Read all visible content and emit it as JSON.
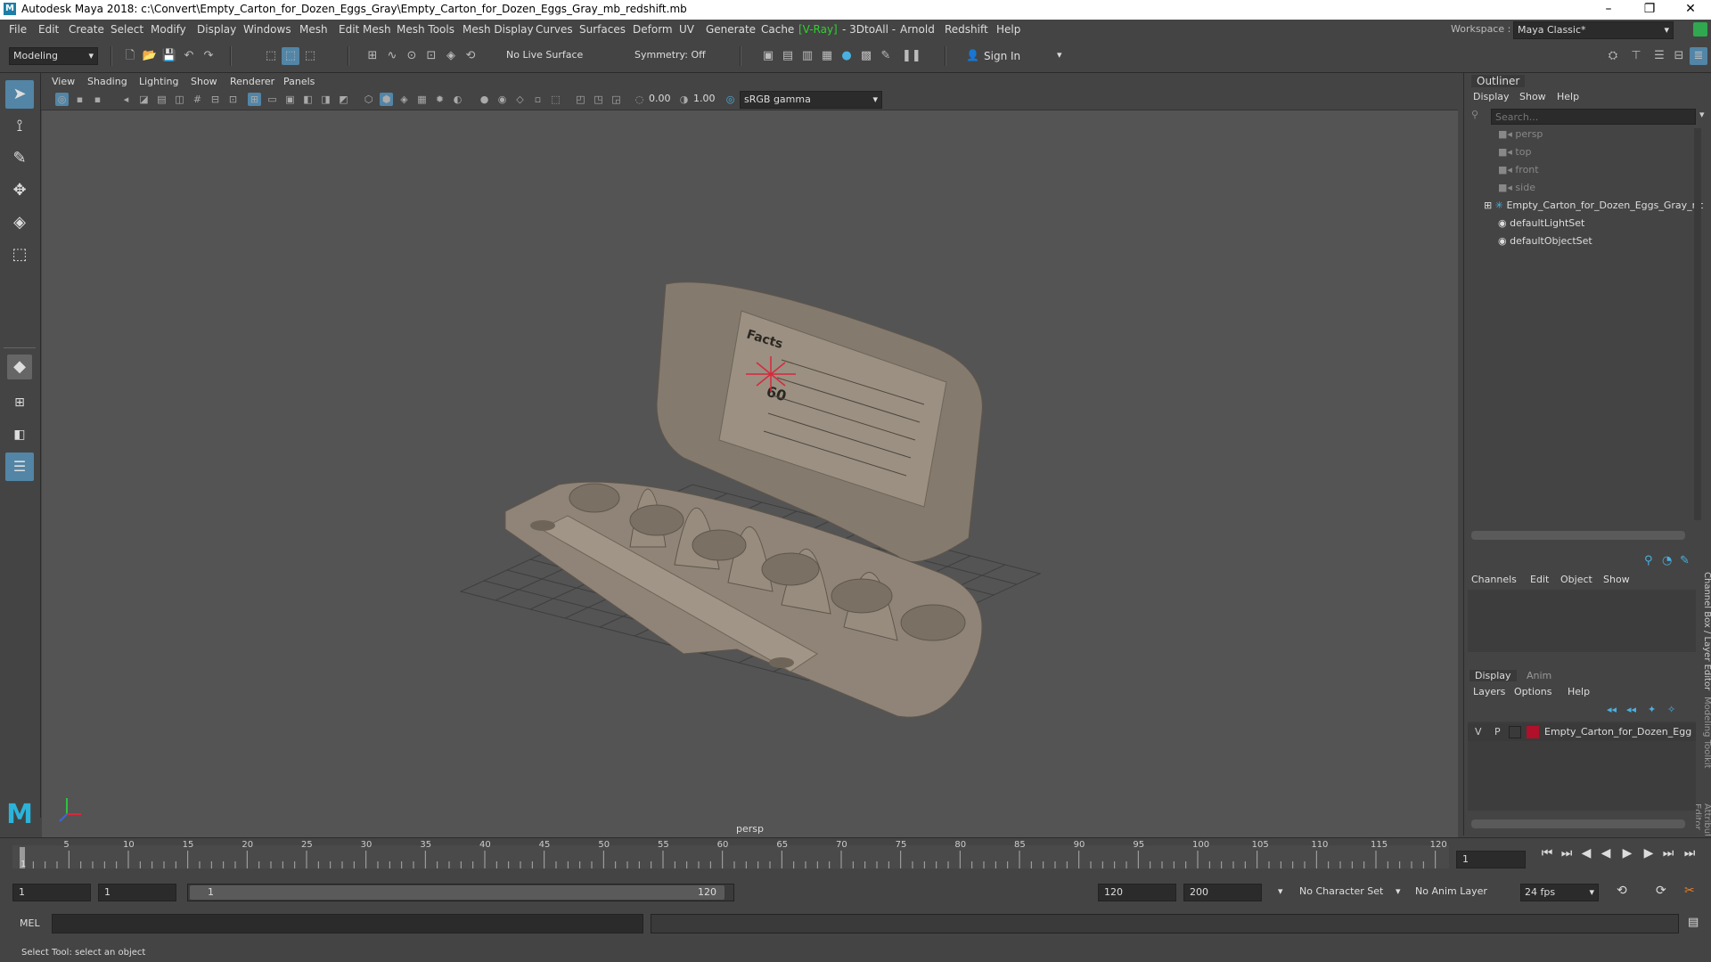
{
  "window": {
    "title": "Autodesk Maya 2018: c:\\Convert\\Empty_Carton_for_Dozen_Eggs_Gray\\Empty_Carton_for_Dozen_Eggs_Gray_mb_redshift.mb",
    "logo_letter": "M",
    "minimize": "–",
    "maximize": "❐",
    "close": "✕"
  },
  "menu": {
    "items": [
      "File",
      "Edit",
      "Create",
      "Select",
      "Modify",
      "Display",
      "Windows",
      "Mesh",
      "Edit Mesh",
      "Mesh Tools",
      "Mesh Display",
      "Curves",
      "Surfaces",
      "Deform",
      "UV",
      "Generate",
      "Cache",
      "[V-Ray]",
      "- 3DtoAll -",
      "Arnold",
      "Redshift",
      "Help"
    ],
    "workspace_label": "Workspace :",
    "workspace_value": "Maya Classic*"
  },
  "toolbar": {
    "mode": "Modeling",
    "live_surface": "No Live Surface",
    "symmetry": "Symmetry: Off",
    "sign_in": "Sign In"
  },
  "viewport": {
    "menus": [
      "View",
      "Shading",
      "Lighting",
      "Show",
      "Renderer",
      "Panels"
    ],
    "exposure": "0.00",
    "gamma": "1.00",
    "color_space": "sRGB gamma",
    "camera_label": "persp",
    "model_facts_title": "Facts",
    "model_facts_number": "60"
  },
  "outliner": {
    "title": "Outliner",
    "menus": [
      "Display",
      "Show",
      "Help"
    ],
    "search_placeholder": "Search...",
    "items": [
      {
        "label": "persp",
        "type": "camera"
      },
      {
        "label": "top",
        "type": "camera"
      },
      {
        "label": "front",
        "type": "camera"
      },
      {
        "label": "side",
        "type": "camera"
      },
      {
        "label": "Empty_Carton_for_Dozen_Eggs_Gray_nc",
        "type": "group"
      },
      {
        "label": "defaultLightSet",
        "type": "set"
      },
      {
        "label": "defaultObjectSet",
        "type": "set"
      }
    ]
  },
  "channelbox": {
    "menus": [
      "Channels",
      "Edit",
      "Object",
      "Show"
    ],
    "side_label": "Channel Box / Layer Editor",
    "side_label2": "Modeling Toolkit",
    "side_label3": "Attribute Editor"
  },
  "layers": {
    "tabs": [
      "Display",
      "Anim"
    ],
    "menus": [
      "Layers",
      "Options",
      "Help"
    ],
    "row": {
      "v": "V",
      "p": "P",
      "name": "Empty_Carton_for_Dozen_Egg",
      "color": "#b0102a"
    }
  },
  "timeline": {
    "ticks": [
      "5",
      "10",
      "15",
      "20",
      "25",
      "30",
      "35",
      "40",
      "45",
      "50",
      "55",
      "60",
      "65",
      "70",
      "75",
      "80",
      "85",
      "90",
      "95",
      "100",
      "105",
      "110",
      "115",
      "120"
    ],
    "current_frame": "1",
    "frame_field": "1"
  },
  "range": {
    "start": "1",
    "playback_start": "1",
    "slider_start": "1",
    "slider_end": "120",
    "playback_end": "120",
    "end": "200",
    "character_set": "No Character Set",
    "anim_layer": "No Anim Layer",
    "fps": "24 fps"
  },
  "cmd": {
    "label": "MEL"
  },
  "status": {
    "text": "Select Tool: select an object"
  },
  "colors": {
    "accent": "#5285a6",
    "vray": "#2fd12f",
    "layer": "#b0102a"
  }
}
